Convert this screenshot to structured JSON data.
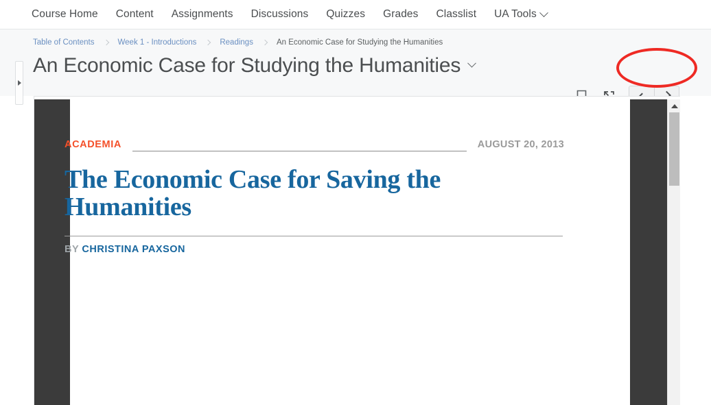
{
  "nav": {
    "items": [
      {
        "label": "Course Home",
        "icon": null
      },
      {
        "label": "Content",
        "icon": null
      },
      {
        "label": "Assignments",
        "icon": null
      },
      {
        "label": "Discussions",
        "icon": null
      },
      {
        "label": "Quizzes",
        "icon": null
      },
      {
        "label": "Grades",
        "icon": null
      },
      {
        "label": "Classlist",
        "icon": null
      },
      {
        "label": "UA Tools",
        "icon": "chevron-down-icon"
      }
    ]
  },
  "header": {
    "breadcrumb": [
      {
        "label": "Table of Contents",
        "current": false
      },
      {
        "label": "Week 1 - Introductions",
        "current": false
      },
      {
        "label": "Readings",
        "current": false
      },
      {
        "label": "An Economic Case for Studying the Humanities",
        "current": true
      }
    ],
    "title": "An Economic Case for Studying the Humanities",
    "title_caret_icon": "chevron-down-icon",
    "tools": {
      "bookmark_icon": "bookmark-icon",
      "fullscreen_icon": "fullscreen-expand-icon",
      "prev_icon": "chevron-left-icon",
      "next_icon": "chevron-right-icon"
    },
    "annotation": {
      "shape": "ellipse",
      "color": "#ee2a24",
      "target": "pager-navigation-buttons"
    }
  },
  "sidebar": {
    "collapse_handle_icon": "triangle-right-icon"
  },
  "viewer": {
    "scrollbar": {
      "up_arrow_icon": "triangle-up-icon"
    }
  },
  "article": {
    "kicker": "ACADEMIA",
    "pubdate": "AUGUST 20, 2013",
    "headline": "The Economic Case for Saving the Humanities",
    "by_label": "BY",
    "author": "CHRISTINA PAXSON",
    "colors": {
      "kicker": "#f4502a",
      "headline": "#17669e",
      "pubdate": "#9a9a9a"
    }
  }
}
